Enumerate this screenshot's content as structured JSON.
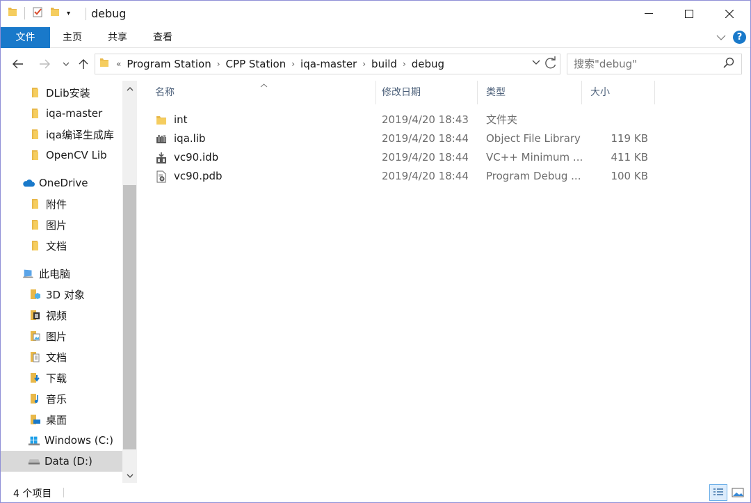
{
  "window": {
    "title": "debug"
  },
  "ribbon": {
    "tabs": [
      "文件",
      "主页",
      "共享",
      "查看"
    ],
    "help_label": "?"
  },
  "address": {
    "overflow": "«",
    "crumbs": [
      "Program Station",
      "CPP Station",
      "iqa-master",
      "build",
      "debug"
    ]
  },
  "search": {
    "placeholder": "搜索\"debug\""
  },
  "sidebar": {
    "items": [
      {
        "label": "DLib安装",
        "icon": "folder-icon"
      },
      {
        "label": "iqa-master",
        "icon": "folder-icon"
      },
      {
        "label": "iqa编译生成库",
        "icon": "folder-icon"
      },
      {
        "label": "OpenCV Lib",
        "icon": "folder-icon"
      },
      {
        "label": "OneDrive",
        "icon": "cloud-icon"
      },
      {
        "label": "附件",
        "icon": "folder-icon"
      },
      {
        "label": "图片",
        "icon": "folder-icon"
      },
      {
        "label": "文档",
        "icon": "folder-icon"
      },
      {
        "label": "此电脑",
        "icon": "computer-icon"
      },
      {
        "label": "3D 对象",
        "icon": "3d-objects-icon"
      },
      {
        "label": "视频",
        "icon": "video-folder-icon"
      },
      {
        "label": "图片",
        "icon": "pictures-folder-icon"
      },
      {
        "label": "文档",
        "icon": "documents-folder-icon"
      },
      {
        "label": "下载",
        "icon": "downloads-folder-icon"
      },
      {
        "label": "音乐",
        "icon": "music-folder-icon"
      },
      {
        "label": "桌面",
        "icon": "desktop-folder-icon"
      },
      {
        "label": "Windows (C:)",
        "icon": "windows-drive-icon"
      },
      {
        "label": "Data (D:)",
        "icon": "drive-icon"
      }
    ]
  },
  "files": {
    "columns": [
      "名称",
      "修改日期",
      "类型",
      "大小"
    ],
    "rows": [
      {
        "name": "int",
        "date": "2019/4/20 18:43",
        "type": "文件夹",
        "size": "",
        "icon": "folder-icon"
      },
      {
        "name": "iqa.lib",
        "date": "2019/4/20 18:44",
        "type": "Object File Library",
        "size": "119 KB",
        "icon": "library-file-icon"
      },
      {
        "name": "vc90.idb",
        "date": "2019/4/20 18:44",
        "type": "VC++ Minimum ...",
        "size": "411 KB",
        "icon": "idb-file-icon"
      },
      {
        "name": "vc90.pdb",
        "date": "2019/4/20 18:44",
        "type": "Program Debug ...",
        "size": "100 KB",
        "icon": "pdb-file-icon"
      }
    ]
  },
  "status": {
    "item_count": "4 个项目"
  },
  "colors": {
    "accent": "#1979ca",
    "folder": "#e8b84a",
    "selected": "#d9d9d9"
  }
}
